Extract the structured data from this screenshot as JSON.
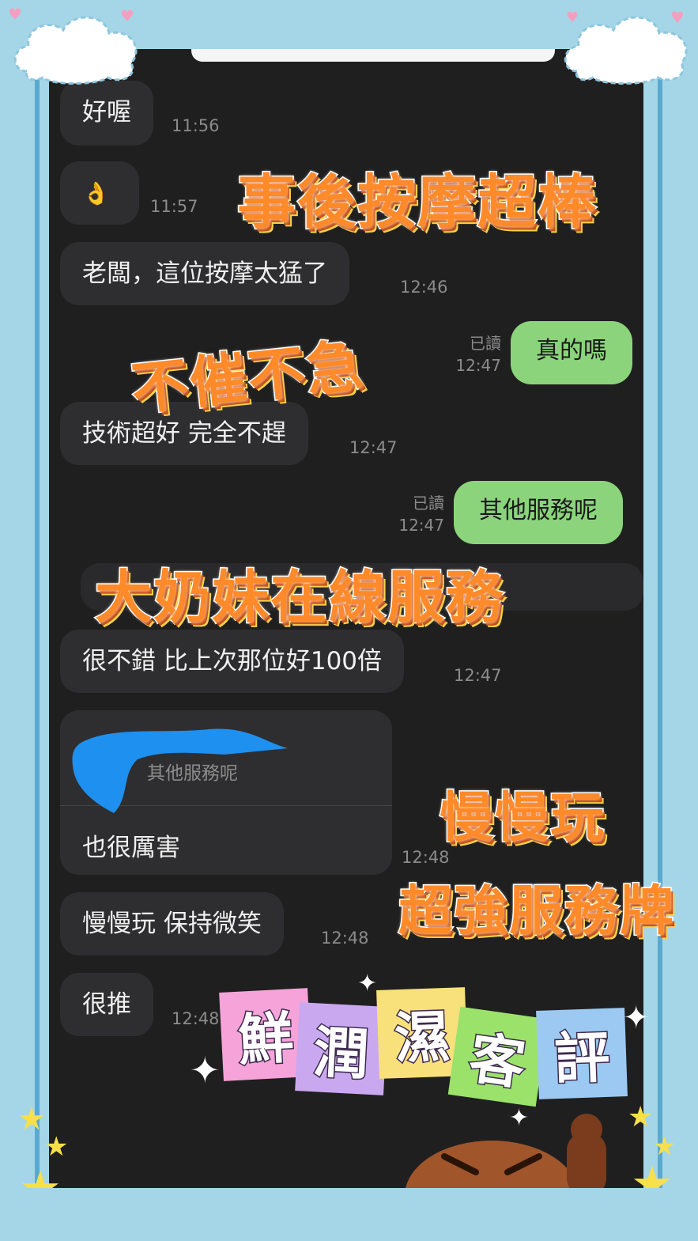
{
  "colors": {
    "frame": "#a5d6e8",
    "screen": "#1f1f1f",
    "incoming_bubble": "#2e2e30",
    "outgoing_bubble": "#8bd47c",
    "overlay_text": "#ff8a2a"
  },
  "messages": [
    {
      "side": "in",
      "text": "好喔",
      "time": "11:56"
    },
    {
      "side": "in",
      "icon": "ok-hand-emoji",
      "text": "👌",
      "time": "11:57"
    },
    {
      "side": "in",
      "text": "老闆，這位按摩太猛了",
      "time": "12:46"
    },
    {
      "side": "out",
      "text": "真的嗎",
      "read": "已讀",
      "time": "12:47"
    },
    {
      "side": "in",
      "text": "技術超好 完全不趕",
      "time": "12:47"
    },
    {
      "side": "out",
      "text": "其他服務呢",
      "read": "已讀",
      "time": "12:47"
    },
    {
      "side": "in",
      "text": "很不錯 比上次那位好100倍",
      "time": "12:47"
    },
    {
      "side": "in",
      "quote": "其他服務呢",
      "text": "也很厲害",
      "time": "12:48"
    },
    {
      "side": "in",
      "text": "慢慢玩 保持微笑",
      "time": "12:48"
    },
    {
      "side": "in",
      "text": "很推",
      "time": "12:48"
    }
  ],
  "overlays": {
    "line1": "事後按摩超棒",
    "line2": "不催不急",
    "line3": "大奶妹在線服務",
    "line4": "慢慢玩",
    "line5": "超強服務牌"
  },
  "stamp": {
    "chars": [
      "鮮",
      "潤",
      "濕",
      "客",
      "評"
    ],
    "colors": [
      "#f5a3d8",
      "#c9a8f0",
      "#f8e07a",
      "#9be26b",
      "#9cc9f2"
    ]
  },
  "scroll_button": {
    "icon": "chevron-up-icon",
    "glyph": "^"
  }
}
